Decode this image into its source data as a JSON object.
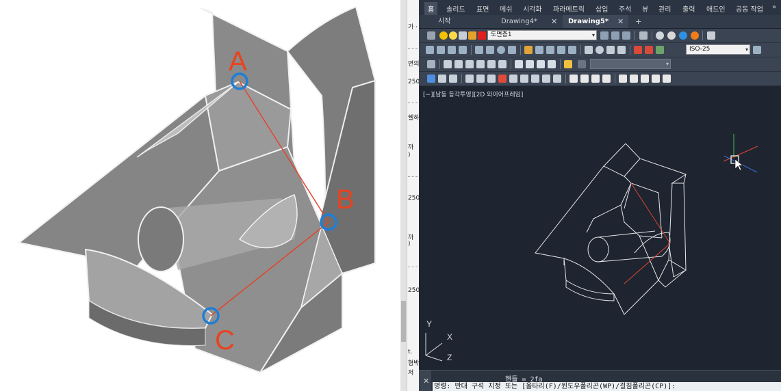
{
  "left_panel": {
    "labels": [
      "A",
      "B",
      "C"
    ]
  },
  "sliver": {
    "fragments": [
      "가 ·",
      "면의",
      "250",
      "쉘하",
      "까",
      ")",
      "250",
      "까",
      ")",
      "250",
      "t. ",
      "혐박",
      "저"
    ]
  },
  "ribbon": {
    "tabs": [
      "홈",
      "솔리드",
      "표면",
      "메쉬",
      "시각화",
      "파라메트릭",
      "삽입",
      "주석",
      "뷰",
      "관리",
      "출력",
      "애드인",
      "공동 작업"
    ],
    "active_tab": "홈",
    "overflow_icon": "double-chevron-right-icon"
  },
  "doc_tabs": {
    "start": "시작",
    "tab1": "Drawing4*",
    "tab2": "Drawing5*",
    "active": "Drawing5*",
    "close_glyph": "✕",
    "new_tab_glyph": "+"
  },
  "toolbar": {
    "layer_name": "도면층1",
    "dimstyle": "ISO-25",
    "empty_combo": ""
  },
  "viewport": {
    "label": "[−][남동 등각투영][2D 와이어프레임]"
  },
  "ucs": {
    "x": "X",
    "y": "Y",
    "z": "Z"
  },
  "command": {
    "history": "핸들 = 2fa",
    "prompt": "명령: 반대 구석 지정 또는 [울타리(F)/윈도우폴리곤(WP)/걸침폴리곤(CP)]:",
    "close_glyph": "✕"
  },
  "colors": {
    "label_red": "#e8431f",
    "handle_blue": "#1f7ed6",
    "cad_background": "#1e2531",
    "wire_white": "#e6e6e6",
    "red_line": "#e0452b"
  }
}
